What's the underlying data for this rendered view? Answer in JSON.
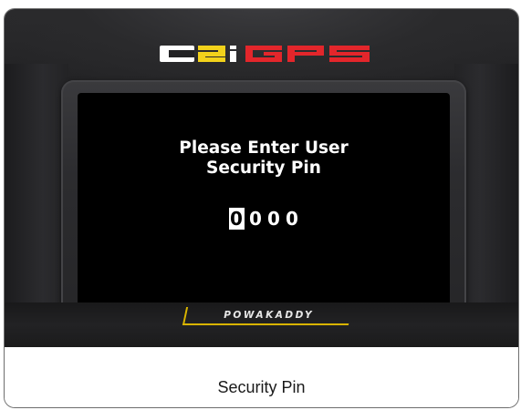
{
  "device": {
    "logo_text": "C2i GPS",
    "brand_badge": "POWAKADDY",
    "colors": {
      "logo_white": "#ffffff",
      "logo_yellow": "#f2d21b",
      "logo_red": "#e3262b",
      "badge_accent": "#d9b400",
      "screen_bg": "#000000"
    }
  },
  "screen": {
    "prompt_line1": "Please Enter User",
    "prompt_line2": "Security Pin",
    "pin_digits": [
      "0",
      "0",
      "0",
      "0"
    ],
    "active_digit_index": 0
  },
  "caption": "Security Pin"
}
